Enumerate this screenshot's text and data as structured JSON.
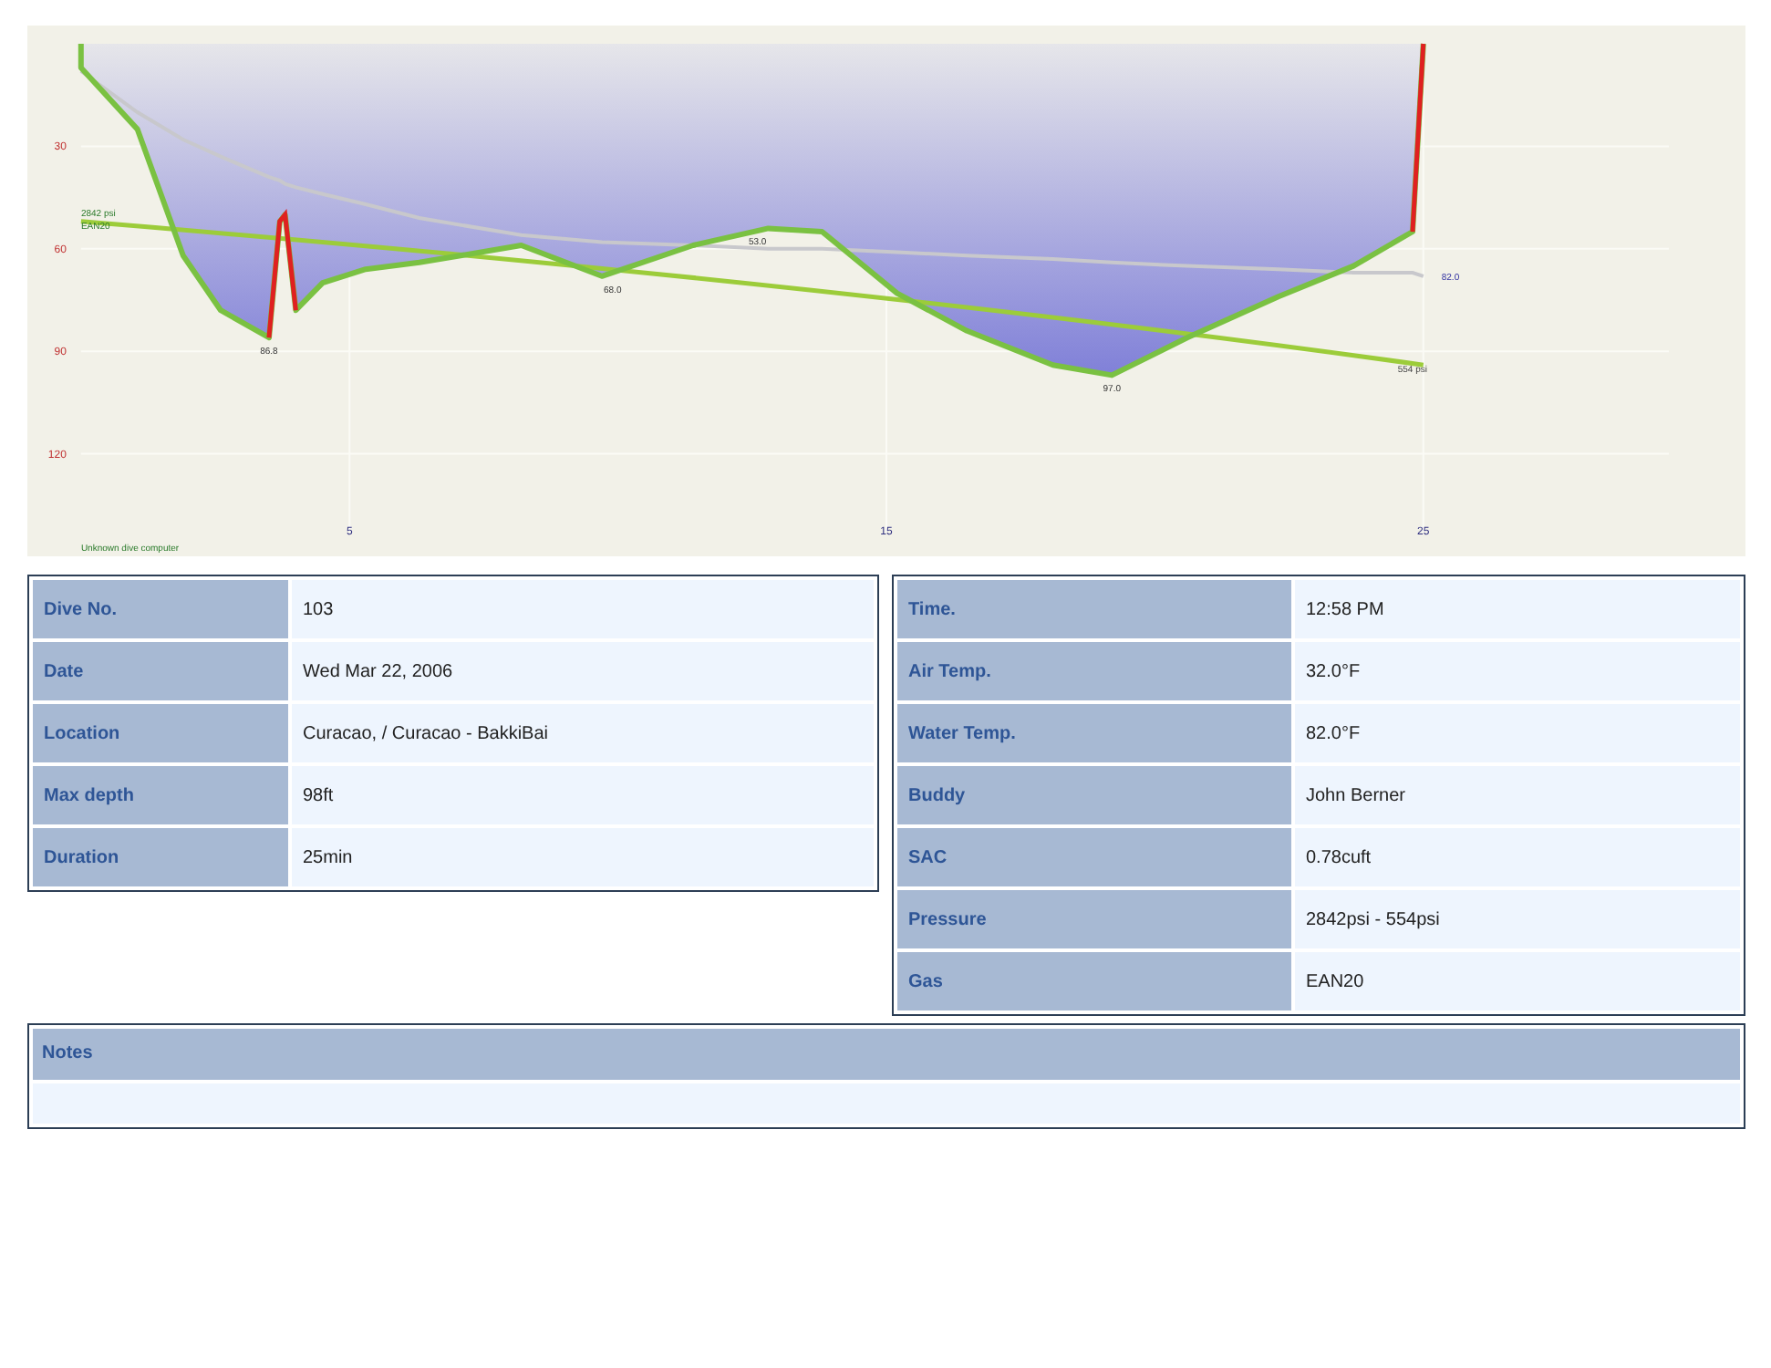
{
  "profile": {
    "chart_data": {
      "type": "area",
      "grid": true,
      "x": [
        0,
        0,
        1.05,
        1.9,
        2.6,
        3.5,
        3.7,
        3.8,
        4.0,
        4.5,
        5.3,
        6.3,
        8.2,
        9.7,
        11.4,
        12.8,
        13.8,
        15.2,
        16.5,
        18.1,
        19.2,
        20.6,
        22.3,
        23.7,
        24.8,
        25
      ],
      "series": [
        {
          "color": "#7ac142",
          "values": [
            0,
            7,
            25,
            62,
            78,
            86,
            52,
            50,
            78,
            70,
            66,
            64,
            59,
            68,
            59,
            54,
            55,
            73,
            84,
            94,
            97,
            86,
            74,
            65,
            55,
            0
          ]
        },
        {
          "type": "line",
          "color": "#c8c8cc",
          "values": [
            8,
            8,
            20,
            28,
            33,
            39,
            40,
            41,
            42,
            44,
            47,
            51,
            56,
            58,
            59,
            60,
            60,
            61,
            62,
            63,
            64,
            65,
            66,
            67,
            67,
            68
          ]
        }
      ],
      "xlim": [
        -1,
        31
      ],
      "ylim": [
        150,
        0
      ],
      "xticks": [
        5,
        15,
        25
      ],
      "yticks": [
        30,
        60,
        90,
        120
      ],
      "annotations": [
        {
          "x": 3.5,
          "y": 86,
          "text": "86.8"
        },
        {
          "x": 9.9,
          "y": 68,
          "text": "68.0"
        },
        {
          "x": 12.6,
          "y": 54,
          "text": "53.0"
        },
        {
          "x": 19.2,
          "y": 97,
          "text": "97.0"
        }
      ]
    },
    "start_pressure": "2842 psi",
    "gas": "EAN20",
    "end_pressure": "554 psi",
    "end_label": "82.0",
    "computer": "Unknown dive computer"
  },
  "details_left": [
    {
      "label": "Dive No.",
      "value": "103"
    },
    {
      "label": "Date",
      "value": "Wed Mar 22, 2006"
    },
    {
      "label": "Location",
      "value": "Curacao, / Curacao - BakkiBai"
    },
    {
      "label": "Max depth",
      "value": "98ft"
    },
    {
      "label": "Duration",
      "value": "25min"
    }
  ],
  "details_right": [
    {
      "label": "Time.",
      "value": "12:58 PM"
    },
    {
      "label": "Air Temp.",
      "value": "32.0°F"
    },
    {
      "label": "Water Temp.",
      "value": "82.0°F"
    },
    {
      "label": "Buddy",
      "value": "John Berner"
    },
    {
      "label": "SAC",
      "value": "0.78cuft"
    },
    {
      "label": "Pressure",
      "value": "2842psi - 554psi"
    },
    {
      "label": "Gas",
      "value": "EAN20"
    }
  ],
  "notes": {
    "label": "Notes"
  }
}
